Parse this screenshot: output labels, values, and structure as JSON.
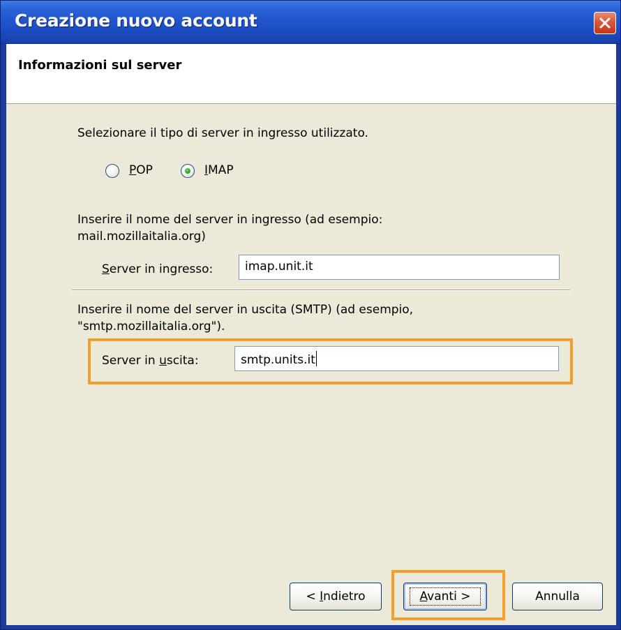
{
  "window": {
    "title": "Creazione nuovo account",
    "close_symbol": "×"
  },
  "header": {
    "title": "Informazioni sul server"
  },
  "server_type": {
    "prompt": "Selezionare il tipo di server in ingresso utilizzato.",
    "options": [
      {
        "label": "POP",
        "mnemonic": "P",
        "rest": "OP",
        "selected": false
      },
      {
        "label": "IMAP",
        "mnemonic": "I",
        "rest": "MAP",
        "selected": true
      }
    ]
  },
  "incoming": {
    "description_line1": "Inserire il nome del server in ingresso (ad esempio:",
    "description_line2": "mail.mozillaitalia.org)",
    "label_mnemonic": "S",
    "label_rest": "erver in ingresso:",
    "value": "imap.unit.it"
  },
  "outgoing": {
    "description_line1": "Inserire il nome del server in uscita (SMTP) (ad esempio,",
    "description_line2": "\"smtp.mozillaitalia.org\").",
    "label_before": "Server in ",
    "label_mnemonic": "u",
    "label_after": "scita:",
    "value": "smtp.units.it"
  },
  "buttons": {
    "back_prefix": "< ",
    "back_mnemonic": "I",
    "back_rest": "ndietro",
    "next_mnemonic": "A",
    "next_rest": "vanti >",
    "cancel_label": "Annulla"
  },
  "colors": {
    "titlebar": "#2a63d8",
    "highlight": "#f1a02b",
    "dialog_bg": "#ece9d8",
    "radio_selected": "#2c9a26"
  },
  "icons": {
    "close": "close-icon",
    "radio_selected": "radio-selected-dot"
  }
}
